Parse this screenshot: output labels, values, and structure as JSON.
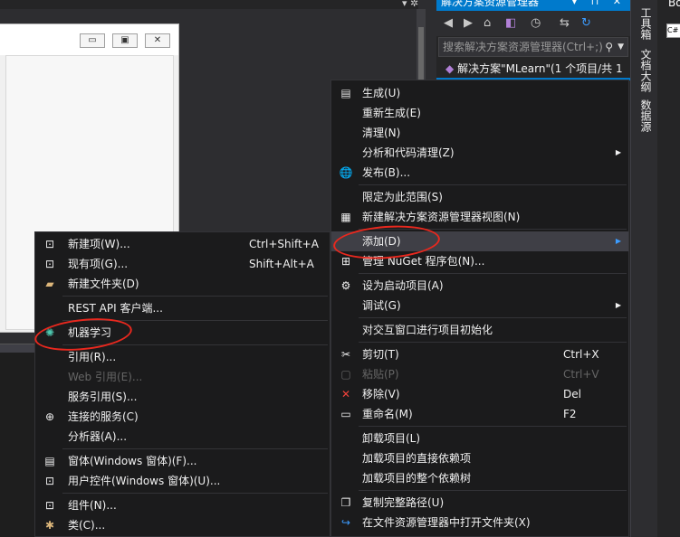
{
  "solution_explorer": {
    "title": "解决方案资源管理器",
    "title_buttons": "▾ ⊓ ✕",
    "search_placeholder": "搜索解决方案资源管理器(Ctrl+;)",
    "solution_node": "解决方案\"MLearn\"(1 个项目/共 1"
  },
  "right_tabs": {
    "toolbox": "工具箱",
    "document_outline": "文档大纲",
    "data_sources": "数据源"
  },
  "far_right": {
    "title": "Bo",
    "box_label": "C#"
  },
  "context_menu": {
    "items": [
      {
        "icon": "build-icon",
        "label": "生成(U)"
      },
      {
        "label": "重新生成(E)"
      },
      {
        "label": "清理(N)"
      },
      {
        "label": "分析和代码清理(Z)",
        "submenu": true
      },
      {
        "icon": "publish-icon",
        "label": "发布(B)..."
      },
      {
        "label": "限定为此范围(S)"
      },
      {
        "icon": "new-view-icon",
        "label": "新建解决方案资源管理器视图(N)"
      },
      {
        "label": "添加(D)",
        "submenu": true
      },
      {
        "icon": "nuget-icon",
        "label": "管理 NuGet 程序包(N)..."
      },
      {
        "icon": "gear-icon",
        "label": "设为启动项目(A)"
      },
      {
        "label": "调试(G)",
        "submenu": true
      },
      {
        "label": "对交互窗口进行项目初始化"
      },
      {
        "icon": "cut-icon",
        "label": "剪切(T)",
        "shortcut": "Ctrl+X"
      },
      {
        "icon": "paste-icon",
        "label": "粘贴(P)",
        "shortcut": "Ctrl+V"
      },
      {
        "icon": "remove-icon",
        "label": "移除(V)",
        "shortcut": "Del"
      },
      {
        "icon": "rename-icon",
        "label": "重命名(M)",
        "shortcut": "F2"
      },
      {
        "label": "卸载项目(L)"
      },
      {
        "label": "加载项目的直接依赖项"
      },
      {
        "label": "加载项目的整个依赖树"
      },
      {
        "icon": "copy-icon",
        "label": "复制完整路径(U)"
      },
      {
        "icon": "folder-open-icon",
        "label": "在文件资源管理器中打开文件夹(X)"
      }
    ]
  },
  "add_submenu": {
    "items": [
      {
        "icon": "new-item-icon",
        "label": "新建项(W)...",
        "shortcut": "Ctrl+Shift+A"
      },
      {
        "icon": "existing-item-icon",
        "label": "现有项(G)...",
        "shortcut": "Shift+Alt+A"
      },
      {
        "icon": "new-folder-icon",
        "label": "新建文件夹(D)"
      },
      {
        "label": "REST API 客户端..."
      },
      {
        "icon": "machine-learning-icon",
        "label": "机器学习"
      },
      {
        "label": "引用(R)..."
      },
      {
        "label": "Web 引用(E)..."
      },
      {
        "label": "服务引用(S)..."
      },
      {
        "icon": "connected-service-icon",
        "label": "连接的服务(C)"
      },
      {
        "label": "分析器(A)..."
      },
      {
        "icon": "form-icon",
        "label": "窗体(Windows 窗体)(F)..."
      },
      {
        "icon": "user-control-icon",
        "label": "用户控件(Windows 窗体)(U)..."
      },
      {
        "icon": "component-icon",
        "label": "组件(N)..."
      },
      {
        "icon": "class-icon",
        "label": "类(C)..."
      }
    ]
  },
  "colors": {
    "accent": "#007acc",
    "menu_bg": "#1b1b1c",
    "highlight": "#3f3f46",
    "annotation_red": "#e8281e"
  }
}
